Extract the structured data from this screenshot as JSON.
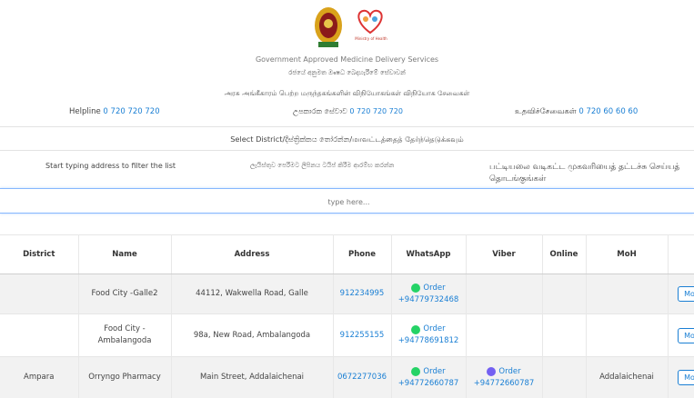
{
  "header": {
    "title": "Government Approved Medicine Delivery Services",
    "title_sinhala": "රජයේ අනුමත ඖෂධ බෙදාහැරීමේ සේවාවන්",
    "title_tamil": "அரசு அங்கீகாரம் பெற்ற மருந்தகங்களின் விநியோகங்கள் விநியோக சேவைகள்",
    "ministry_caption": "Ministry of Health"
  },
  "helplines": {
    "english_label": "Helpline",
    "english_number": "0 720 720 720",
    "sinhala_label": "උපකාරක සේවාව",
    "sinhala_number": "0 720 720 720",
    "tamil_label": "உதவிச்சேவைகள்",
    "tamil_number": "0 720 60 60 60"
  },
  "district_select": {
    "label": "Select District/දිස්ත්‍රික්කය තෝරන්න/மாவட்டத்தைத் தேர்ந்தெடுக்கவும்"
  },
  "filter": {
    "english": "Start typing address to filter the list",
    "sinhala": "ලැයිස්තුව පෙරීමට ලිපිනය ටයිප් කිරීම ආරම්භ කරන්න",
    "tamil": "பட்டியலை வடிகட்ட முகவரியைத் தட்டச்சு செய்யத் தொடங்குங்கள்",
    "placeholder": "type here..."
  },
  "table": {
    "columns": [
      "District",
      "Name",
      "Address",
      "Phone",
      "WhatsApp",
      "Viber",
      "Online",
      "MoH",
      ""
    ],
    "rows": [
      {
        "district": "",
        "name": "Food City -Galle2",
        "address": "44112, Wakwella Road, Galle",
        "phone": "912234995",
        "whatsapp_label": "Order",
        "whatsapp_number": "+94779732468",
        "viber_label": "",
        "viber_number": "",
        "online": "",
        "moh": "",
        "more": "More"
      },
      {
        "district": "",
        "name": "Food City - Ambalangoda",
        "address": "98a, New Road, Ambalangoda",
        "phone": "912255155",
        "whatsapp_label": "Order",
        "whatsapp_number": "+94778691812",
        "viber_label": "",
        "viber_number": "",
        "online": "",
        "moh": "",
        "more": "More"
      },
      {
        "district": "Ampara",
        "name": "Orryngo Pharmacy",
        "address": "Main Street, Addalaichenai",
        "phone": "0672277036",
        "whatsapp_label": "Order",
        "whatsapp_number": "+94772660787",
        "viber_label": "Order",
        "viber_number": "+94772660787",
        "online": "",
        "moh": "Addalaichenai",
        "more": "More"
      }
    ]
  },
  "colors": {
    "link": "#1a7fd4",
    "whatsapp": "#25d366",
    "viber": "#7360f2",
    "focus_border": "#86b7fe"
  }
}
